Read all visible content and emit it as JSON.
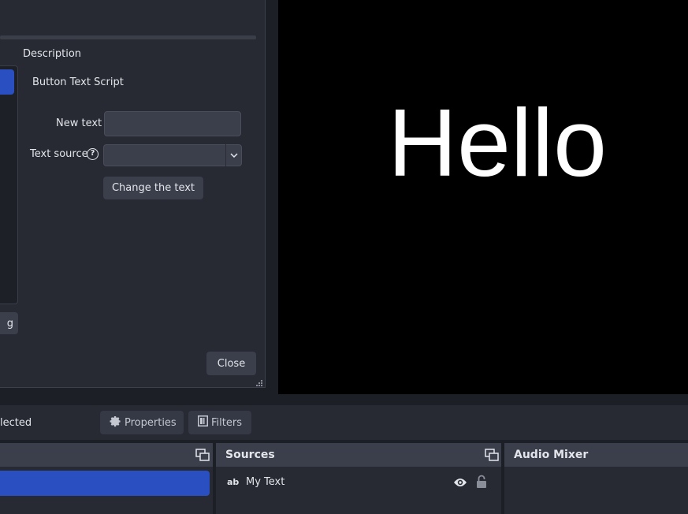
{
  "scripts_dialog": {
    "description_heading": "Description",
    "description_text": "Button Text Script",
    "fields": {
      "new_text_label": "New text",
      "new_text_value": "",
      "text_source_label": "Text source",
      "text_source_value": ""
    },
    "change_button": "Change the text",
    "defaults_button_partial": "g",
    "close_button": "Close"
  },
  "preview": {
    "text": "Hello"
  },
  "context_bar": {
    "selection_status": "lected",
    "properties_button": "Properties",
    "filters_button": "Filters"
  },
  "docks": {
    "sources": {
      "title": "Sources",
      "items": [
        {
          "type_icon": "ab",
          "name": "My Text",
          "visible": true,
          "locked": false
        }
      ]
    },
    "audio_mixer": {
      "title": "Audio Mixer"
    }
  },
  "colors": {
    "accent_selection": "#2a4fc0",
    "panel": "#272a33",
    "preview_bg": "#000000"
  }
}
